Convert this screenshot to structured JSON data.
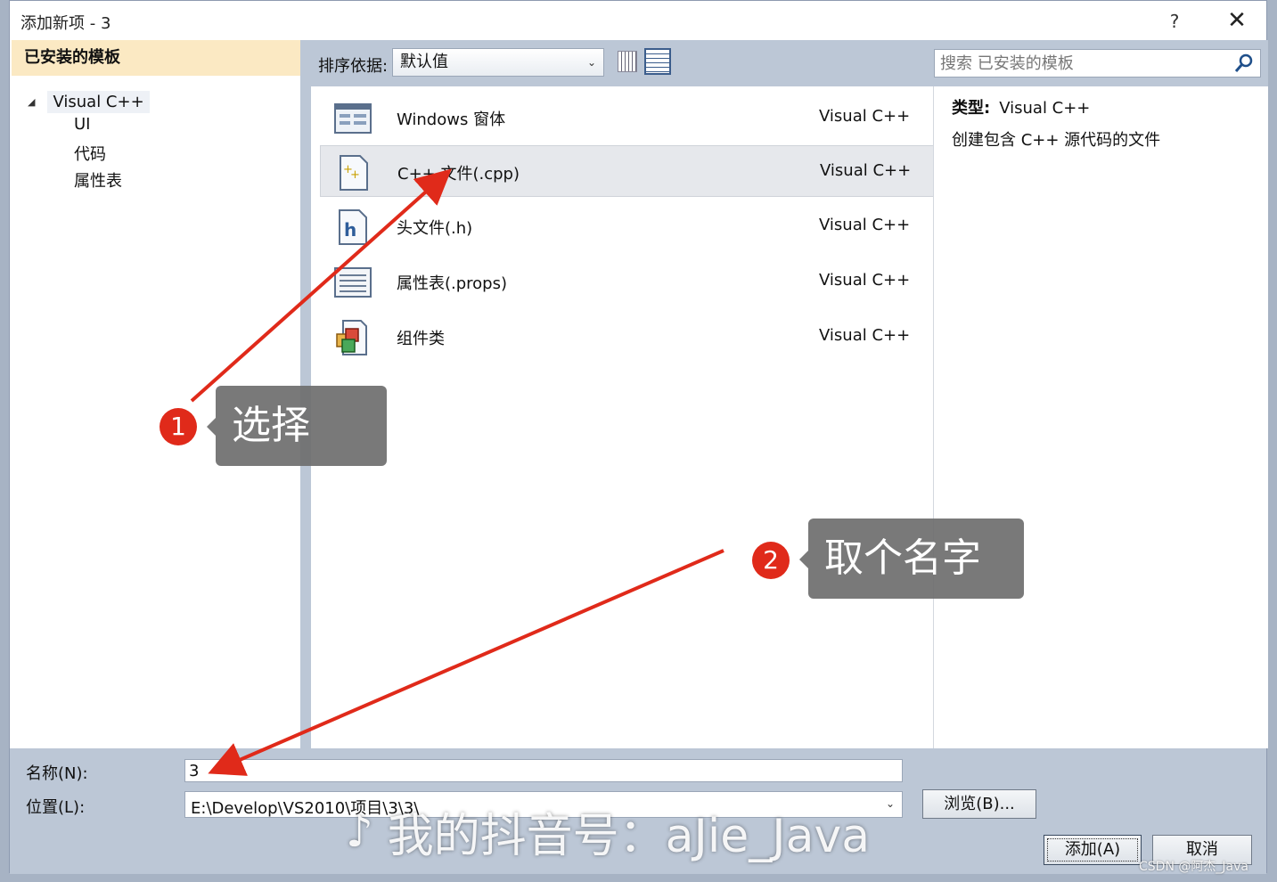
{
  "window": {
    "title": "添加新项 - 3",
    "help_label": "?",
    "close_label": "✕"
  },
  "left": {
    "header": "已安装的模板",
    "tree_root": "Visual C++",
    "children": [
      "UI",
      "代码",
      "属性表"
    ]
  },
  "toolbar": {
    "sort_label": "排序依据:",
    "sort_value": "默认值"
  },
  "search": {
    "placeholder": "搜索 已安装的模板"
  },
  "templates": [
    {
      "name": "Windows 窗体",
      "lang": "Visual C++",
      "icon": "form-icon",
      "selected": false
    },
    {
      "name": "C++ 文件(.cpp)",
      "lang": "Visual C++",
      "icon": "cpp-file-icon",
      "selected": true
    },
    {
      "name": "头文件(.h)",
      "lang": "Visual C++",
      "icon": "header-file-icon",
      "selected": false
    },
    {
      "name": "属性表(.props)",
      "lang": "Visual C++",
      "icon": "property-sheet-icon",
      "selected": false
    },
    {
      "name": "组件类",
      "lang": "Visual C++",
      "icon": "component-class-icon",
      "selected": false
    }
  ],
  "details": {
    "type_label": "类型:",
    "type_value": "Visual C++",
    "description": "创建包含 C++ 源代码的文件"
  },
  "form": {
    "name_label": "名称(N):",
    "name_value": "3",
    "location_label": "位置(L):",
    "location_value": "E:\\Develop\\VS2010\\项目\\3\\3\\",
    "browse_label": "浏览(B)..."
  },
  "buttons": {
    "add": "添加(A)",
    "cancel": "取消"
  },
  "annotations": [
    {
      "number": "1",
      "text": "选择"
    },
    {
      "number": "2",
      "text": "取个名字"
    }
  ],
  "watermark": {
    "text": "我的抖音号：aJie_Java",
    "credit": "CSDN @阿杰_Java"
  },
  "colors": {
    "panel": "#bcc7d6",
    "header_bg": "#fbe9c3",
    "callout_red": "#e02a1a"
  }
}
